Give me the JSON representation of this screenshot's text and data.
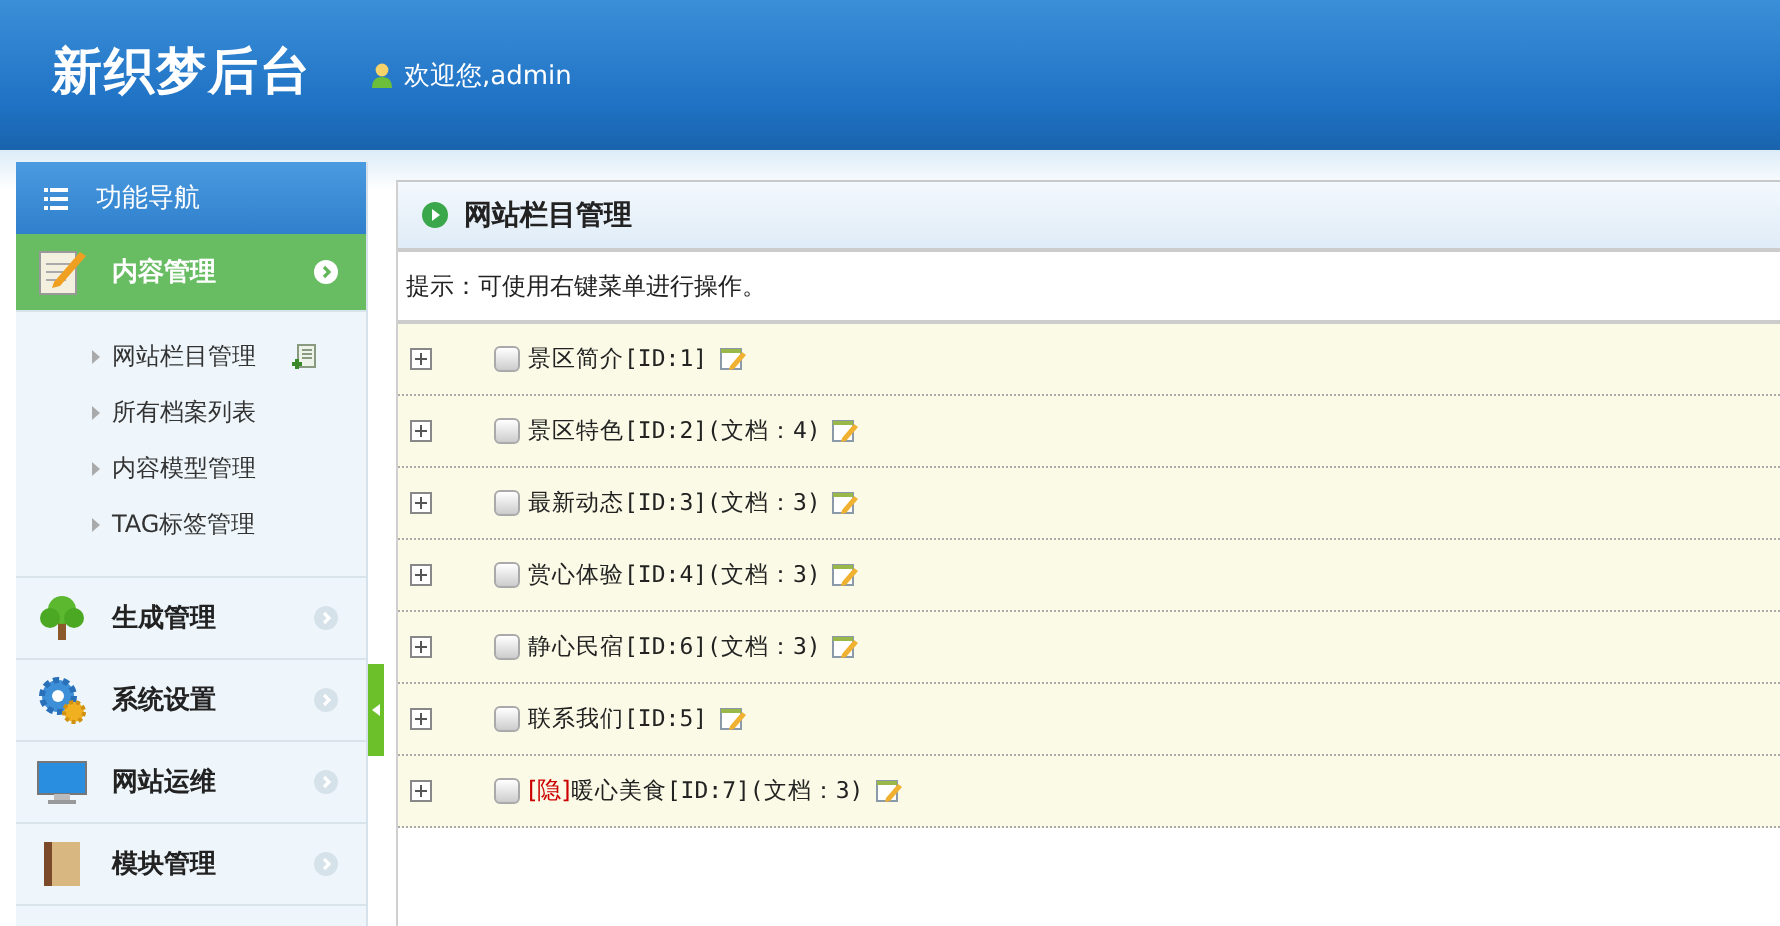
{
  "header": {
    "logo": "新织梦后台",
    "welcome": "欢迎您,admin"
  },
  "sidebar": {
    "title": "功能导航",
    "sections": [
      {
        "label": "内容管理",
        "selected": true,
        "items": [
          {
            "label": "网站栏目管理",
            "has_action": true
          },
          {
            "label": "所有档案列表",
            "has_action": false
          },
          {
            "label": "内容模型管理",
            "has_action": false
          },
          {
            "label": "TAG标签管理",
            "has_action": false
          }
        ]
      },
      {
        "label": "生成管理",
        "selected": false
      },
      {
        "label": "系统设置",
        "selected": false
      },
      {
        "label": "网站运维",
        "selected": false
      },
      {
        "label": "模块管理",
        "selected": false
      }
    ]
  },
  "panel": {
    "title": "网站栏目管理",
    "tip": "提示：可使用右键菜单进行操作。",
    "tree": [
      {
        "label": "景区简介[ID:1]",
        "checked": false
      },
      {
        "label": "景区特色[ID:2](文档：4)",
        "checked": false
      },
      {
        "label": "最新动态[ID:3](文档：3)",
        "checked": false
      },
      {
        "label": "赏心体验[ID:4](文档：3)",
        "checked": false
      },
      {
        "label": "静心民宿[ID:6](文档：3)",
        "checked": false
      },
      {
        "label": "联系我们[ID:5]",
        "checked": false
      },
      {
        "tag": "[隐]",
        "label": "暖心美食[ID:7](文档：3)",
        "checked": false
      }
    ]
  }
}
